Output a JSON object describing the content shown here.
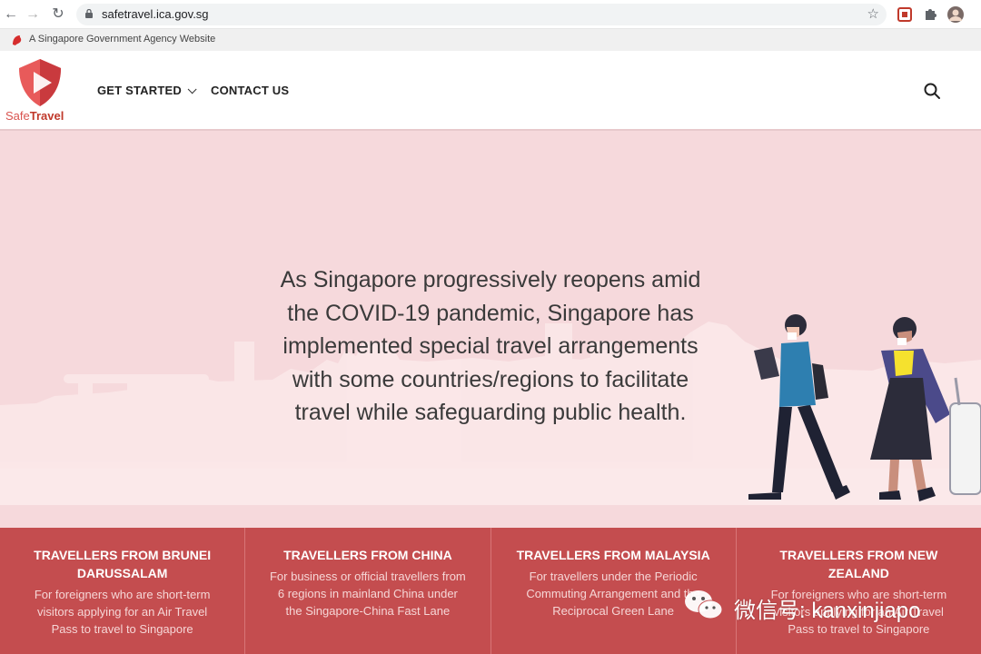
{
  "browser": {
    "url": "safetravel.ica.gov.sg"
  },
  "gov_bar": {
    "text": "A Singapore Government Agency Website"
  },
  "header": {
    "logo_text_part1": "Safe",
    "logo_text_part2": "Travel",
    "nav": [
      {
        "label": "GET STARTED"
      },
      {
        "label": "CONTACT US"
      }
    ]
  },
  "hero": {
    "text": "As Singapore progressively reopens amid the COVID-19 pandemic, Singapore has implemented special travel arrangements with some countries/regions to facilitate travel while safeguarding public health."
  },
  "cards": [
    {
      "title": "TRAVELLERS FROM BRUNEI DARUSSALAM",
      "desc": "For foreigners who are short-term visitors applying for an Air Travel Pass to travel to Singapore"
    },
    {
      "title": "TRAVELLERS FROM CHINA",
      "desc": "For business or official travellers from 6 regions in mainland China under the Singapore-China Fast Lane"
    },
    {
      "title": "TRAVELLERS FROM MALAYSIA",
      "desc": "For travellers under the Periodic Commuting Arrangement and the Reciprocal Green Lane"
    },
    {
      "title": "TRAVELLERS FROM NEW ZEALAND",
      "desc": "For foreigners who are short-term visitors applying for an Air Travel Pass to travel to Singapore"
    }
  ],
  "watermark": {
    "text": "微信号: kanxinjiapo"
  },
  "colors": {
    "brand_red": "#c44d4f",
    "hero_bg": "#f6d9dc"
  }
}
